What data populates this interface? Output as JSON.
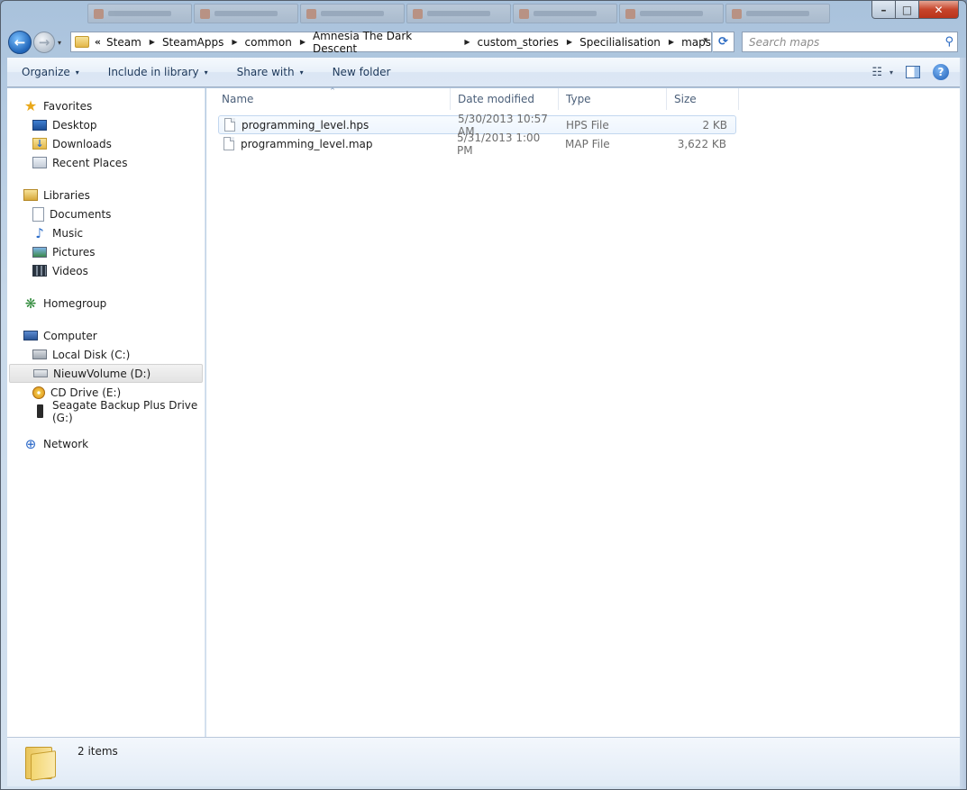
{
  "window": {
    "caption": {
      "minimize": "–",
      "maximize": "□",
      "close": "✕"
    }
  },
  "nav": {
    "back": "←",
    "forward": "→",
    "history_dropdown": "▾",
    "address_overflow": "«",
    "breadcrumbs": [
      "Steam",
      "SteamApps",
      "common",
      "Amnesia The Dark Descent",
      "custom_stories",
      "Specilialisation",
      "maps"
    ],
    "separator": "▶",
    "address_dropdown": "▾",
    "refresh_icon": "refresh-icon",
    "search": {
      "placeholder": "Search maps",
      "icon": "⚲"
    }
  },
  "toolbar": {
    "organize": "Organize",
    "include_in_library": "Include in library",
    "share_with": "Share with",
    "new_folder": "New folder",
    "arrow": "▾",
    "help": "?"
  },
  "sidebar": {
    "favorites": {
      "label": "Favorites",
      "items": [
        "Desktop",
        "Downloads",
        "Recent Places"
      ]
    },
    "libraries": {
      "label": "Libraries",
      "items": [
        "Documents",
        "Music",
        "Pictures",
        "Videos"
      ]
    },
    "homegroup": {
      "label": "Homegroup"
    },
    "computer": {
      "label": "Computer",
      "items": [
        "Local Disk (C:)",
        "NieuwVolume (D:)",
        "CD Drive (E:)",
        "Seagate Backup Plus Drive (G:)"
      ],
      "selected": "NieuwVolume (D:)"
    },
    "network": {
      "label": "Network"
    }
  },
  "files": {
    "columns": {
      "name": "Name",
      "date": "Date modified",
      "type": "Type",
      "size": "Size"
    },
    "sort_indicator": "^",
    "rows": [
      {
        "name": "programming_level.hps",
        "date": "5/30/2013 10:57 AM",
        "type": "HPS File",
        "size": "2 KB"
      },
      {
        "name": "programming_level.map",
        "date": "5/31/2013 1:00 PM",
        "type": "MAP File",
        "size": "3,622 KB"
      }
    ]
  },
  "details": {
    "item_count": "2 items"
  },
  "colors": {
    "accent": "#2b6ac2",
    "selection_border": "#c2d7ef",
    "toolbar_text": "#1e395b"
  }
}
